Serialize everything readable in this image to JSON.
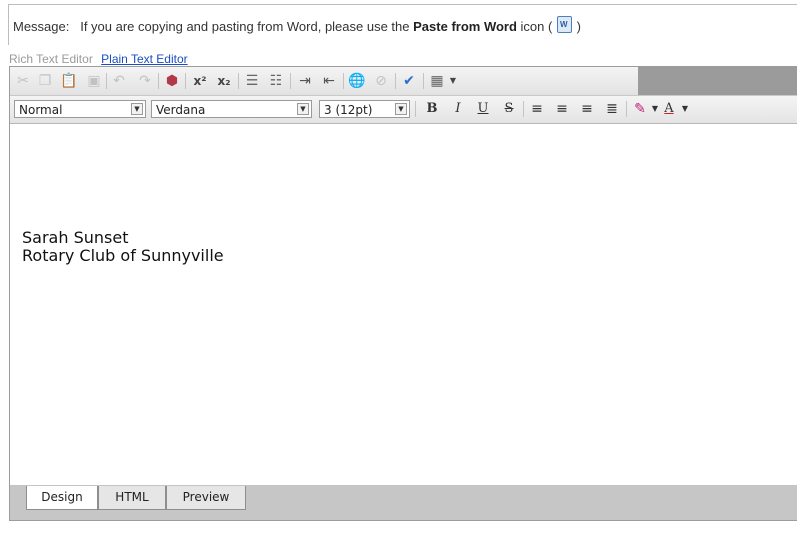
{
  "message": {
    "label": "Message:",
    "text_before": "If you are copying and pasting from Word, please use the",
    "bold_text": "Paste from Word",
    "text_after": "icon (",
    "close_paren": ")"
  },
  "editor_modes": {
    "rich_text": "Rich Text Editor",
    "plain_text": "Plain Text Editor"
  },
  "toolbar1": {
    "icons": [
      "cut-icon",
      "copy-icon",
      "paste-icon",
      "paste-from-word-icon",
      "undo-icon",
      "redo-icon",
      "spellcheck-icon",
      "superscript-icon",
      "subscript-icon",
      "numbered-list-icon",
      "bulleted-list-icon",
      "indent-icon",
      "outdent-icon",
      "insert-link-icon",
      "remove-link-icon",
      "spelling-check-icon",
      "insert-table-icon"
    ]
  },
  "toolbar2": {
    "paragraph_style": "Normal",
    "font_family": "Verdana",
    "font_size": "3 (12pt)"
  },
  "content": {
    "line1": "Sarah Sunset",
    "line2": "Rotary Club of Sunnyville"
  },
  "tabs": [
    {
      "label": "Design",
      "active": true
    },
    {
      "label": "HTML",
      "active": false
    },
    {
      "label": "Preview",
      "active": false
    }
  ]
}
